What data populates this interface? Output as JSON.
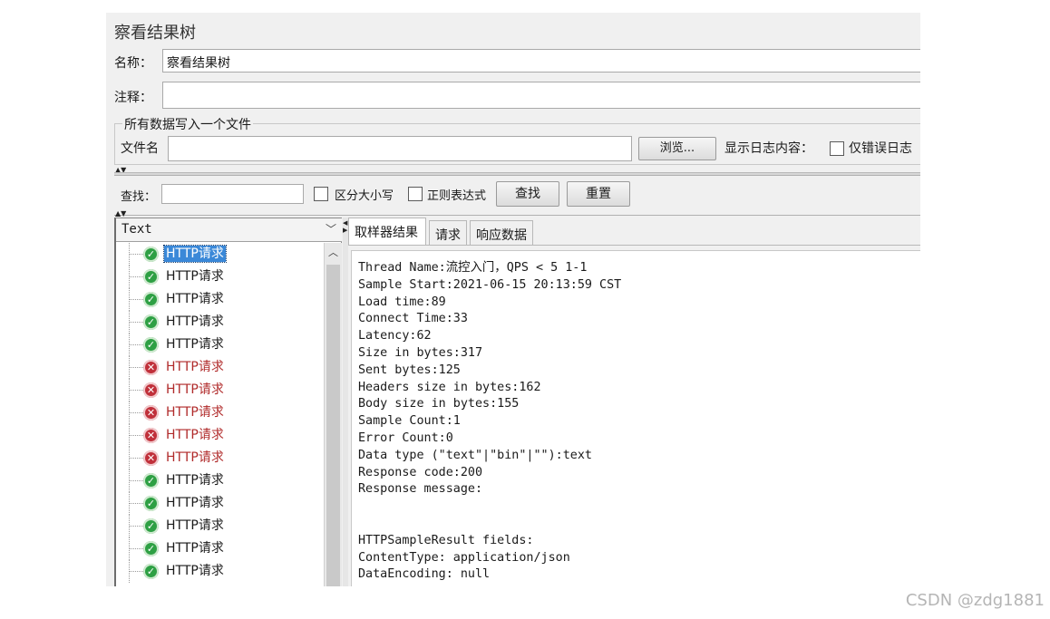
{
  "panel": {
    "title": "察看结果树",
    "name_label": "名称：",
    "name_value": "察看结果树",
    "comment_label": "注释：",
    "comment_value": ""
  },
  "file_group": {
    "legend": "所有数据写入一个文件",
    "filename_label": "文件名",
    "filename_value": "",
    "browse_button": "浏览...",
    "show_log_label": "显示日志内容：",
    "errors_only_label": "仅错误日志"
  },
  "search": {
    "label": "查找：",
    "value": "",
    "case_sensitive_label": "区分大小写",
    "regex_label": "正则表达式",
    "find_button": "查找",
    "reset_button": "重置"
  },
  "renderer": {
    "selected": "Text"
  },
  "tree": {
    "items": [
      {
        "label": "HTTP请求",
        "status": "ok",
        "selected": true
      },
      {
        "label": "HTTP请求",
        "status": "ok"
      },
      {
        "label": "HTTP请求",
        "status": "ok"
      },
      {
        "label": "HTTP请求",
        "status": "ok"
      },
      {
        "label": "HTTP请求",
        "status": "ok"
      },
      {
        "label": "HTTP请求",
        "status": "error"
      },
      {
        "label": "HTTP请求",
        "status": "error"
      },
      {
        "label": "HTTP请求",
        "status": "error"
      },
      {
        "label": "HTTP请求",
        "status": "error"
      },
      {
        "label": "HTTP请求",
        "status": "error"
      },
      {
        "label": "HTTP请求",
        "status": "ok"
      },
      {
        "label": "HTTP请求",
        "status": "ok"
      },
      {
        "label": "HTTP请求",
        "status": "ok"
      },
      {
        "label": "HTTP请求",
        "status": "ok"
      },
      {
        "label": "HTTP请求",
        "status": "ok"
      }
    ]
  },
  "tabs": [
    {
      "label": "取样器结果",
      "active": true
    },
    {
      "label": "请求"
    },
    {
      "label": "响应数据"
    }
  ],
  "result_lines": [
    "Thread Name:流控入门，QPS < 5 1-1",
    "Sample Start:2021-06-15 20:13:59 CST",
    "Load time:89",
    "Connect Time:33",
    "Latency:62",
    "Size in bytes:317",
    "Sent bytes:125",
    "Headers size in bytes:162",
    "Body size in bytes:155",
    "Sample Count:1",
    "Error Count:0",
    "Data type (\"text\"|\"bin\"|\"\"):text",
    "Response code:200",
    "Response message:",
    "",
    "",
    "HTTPSampleResult fields:",
    "ContentType: application/json",
    "DataEncoding: null"
  ],
  "watermark": "CSDN @zdg1881",
  "colors": {
    "ok_icon": "#2ea044",
    "error_icon": "#c0303a",
    "error_text": "#b02a2a",
    "selection": "#3a88d8"
  }
}
